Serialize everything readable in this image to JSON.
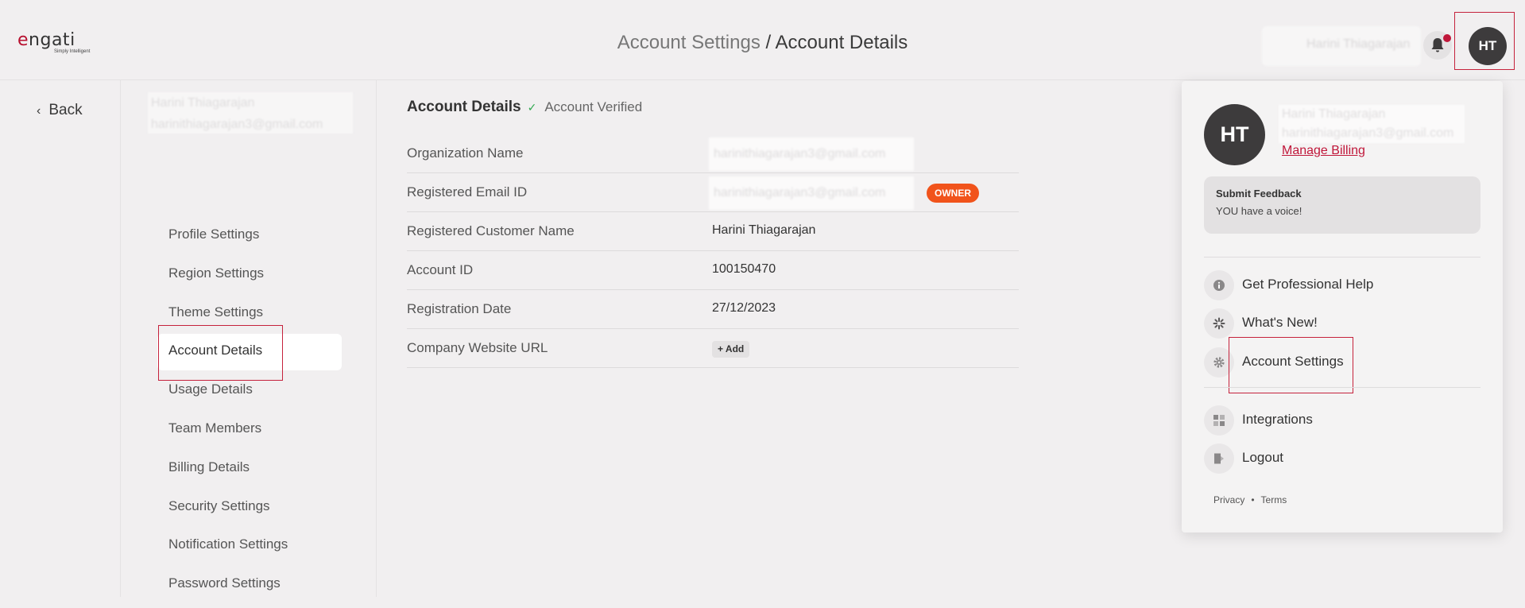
{
  "header": {
    "logo_text_main": "e",
    "logo_text_rest": "ngati",
    "logo_tagline": "Simply Intelligent",
    "breadcrumb_parent": "Account Settings",
    "breadcrumb_separator": " / ",
    "breadcrumb_current": "Account Details",
    "user_name": "Harini Thiagarajan",
    "avatar_initials": "HT",
    "notification_dot_color": "#c0173a"
  },
  "back": {
    "label": "Back"
  },
  "sidebar": {
    "user_name": "Harini Thiagarajan",
    "user_email": "harinithiagarajan3@gmail.com",
    "items": [
      {
        "label": "Profile Settings"
      },
      {
        "label": "Region Settings"
      },
      {
        "label": "Theme Settings"
      },
      {
        "label": "Account Details",
        "active": true
      },
      {
        "label": "Usage Details"
      },
      {
        "label": "Team Members"
      },
      {
        "label": "Billing Details"
      },
      {
        "label": "Security Settings"
      },
      {
        "label": "Notification Settings"
      },
      {
        "label": "Password Settings"
      }
    ]
  },
  "details": {
    "title": "Account Details",
    "verified_label": "Account Verified",
    "rows": [
      {
        "label": "Organization Name",
        "value": "harinithiagarajan3@gmail.com"
      },
      {
        "label": "Registered Email ID",
        "value": "harinithiagarajan3@gmail.com",
        "badge": "OWNER"
      },
      {
        "label": "Registered Customer Name",
        "value": "Harini Thiagarajan"
      },
      {
        "label": "Account ID",
        "value": "100150470"
      },
      {
        "label": "Registration Date",
        "value": "27/12/2023"
      },
      {
        "label": "Company Website URL",
        "action": "+ Add"
      }
    ]
  },
  "dropdown": {
    "avatar_initials": "HT",
    "user_name": "Harini Thiagarajan",
    "user_email": "harinithiagarajan3@gmail.com",
    "manage_billing": "Manage Billing",
    "feedback_title": "Submit Feedback",
    "feedback_subtitle": "YOU have a voice!",
    "items": [
      {
        "label": "Get Professional Help",
        "icon": "info-icon"
      },
      {
        "label": "What's New!",
        "icon": "sparkle-icon"
      },
      {
        "label": "Account Settings",
        "icon": "gear-icon"
      },
      {
        "label": "Integrations",
        "icon": "integrations-icon"
      },
      {
        "label": "Logout",
        "icon": "logout-icon"
      }
    ],
    "footer_privacy": "Privacy",
    "footer_sep": "•",
    "footer_terms": "Terms"
  },
  "colors": {
    "accent": "#c0173a",
    "owner_badge": "#f1531b",
    "verified_check": "#2fa84f"
  }
}
